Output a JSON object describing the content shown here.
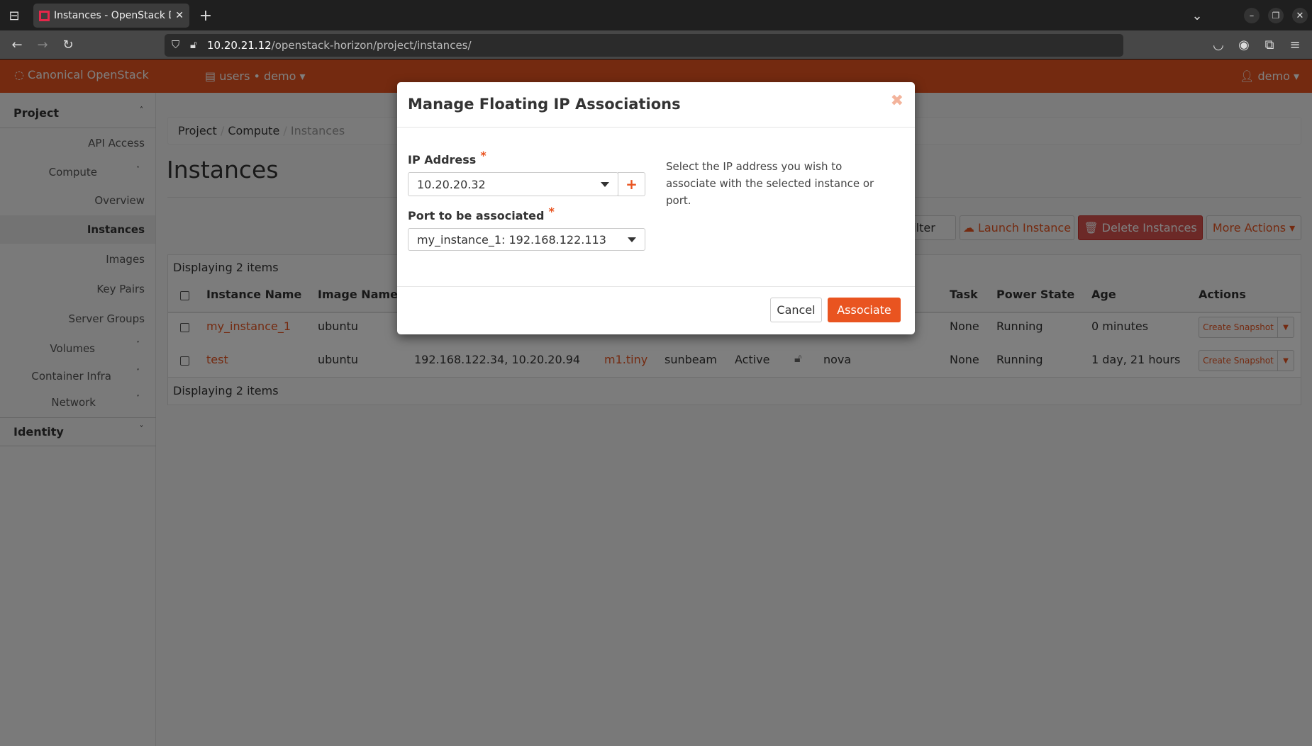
{
  "browser": {
    "tab_title": "Instances - OpenStack Da",
    "url_host": "10.20.21.12",
    "url_path": "/openstack-horizon/project/instances/"
  },
  "header": {
    "brand": "Canonical OpenStack",
    "project_selector": "users • demo",
    "user_menu": "demo"
  },
  "sidebar": {
    "project": "Project",
    "api_access": "API Access",
    "compute": "Compute",
    "overview": "Overview",
    "instances": "Instances",
    "images": "Images",
    "key_pairs": "Key Pairs",
    "server_groups": "Server Groups",
    "volumes": "Volumes",
    "container_infra": "Container Infra",
    "network": "Network",
    "identity": "Identity"
  },
  "breadcrumb": [
    "Project",
    "Compute",
    "Instances"
  ],
  "page_title": "Instances",
  "actions": {
    "filter": "Filter",
    "launch": "Launch Instance",
    "delete": "Delete Instances",
    "more": "More Actions"
  },
  "table": {
    "count_text": "Displaying 2 items",
    "headers": {
      "name": "Instance Name",
      "image": "Image Name",
      "task": "Task",
      "power": "Power State",
      "age": "Age",
      "actions": "Actions"
    },
    "rows": [
      {
        "name": "my_instance_1",
        "image": "ubuntu",
        "ip": "",
        "flavor": "",
        "keypair": "",
        "status": "",
        "az": "",
        "task": "None",
        "power": "Running",
        "age": "0 minutes",
        "action": "Create Snapshot"
      },
      {
        "name": "test",
        "image": "ubuntu",
        "ip": "192.168.122.34, 10.20.20.94",
        "flavor": "m1.tiny",
        "keypair": "sunbeam",
        "status": "Active",
        "az": "nova",
        "task": "None",
        "power": "Running",
        "age": "1 day, 21 hours",
        "action": "Create Snapshot"
      }
    ]
  },
  "modal": {
    "title": "Manage Floating IP Associations",
    "ip_label": "IP Address",
    "ip_value": "10.20.20.32",
    "port_label": "Port to be associated",
    "port_value": "my_instance_1: 192.168.122.113",
    "required_mark": "*",
    "help": "Select the IP address you wish to associate with the selected instance or port.",
    "cancel": "Cancel",
    "associate": "Associate"
  },
  "colors": {
    "accent": "#e95420",
    "danger": "#d9534f"
  }
}
